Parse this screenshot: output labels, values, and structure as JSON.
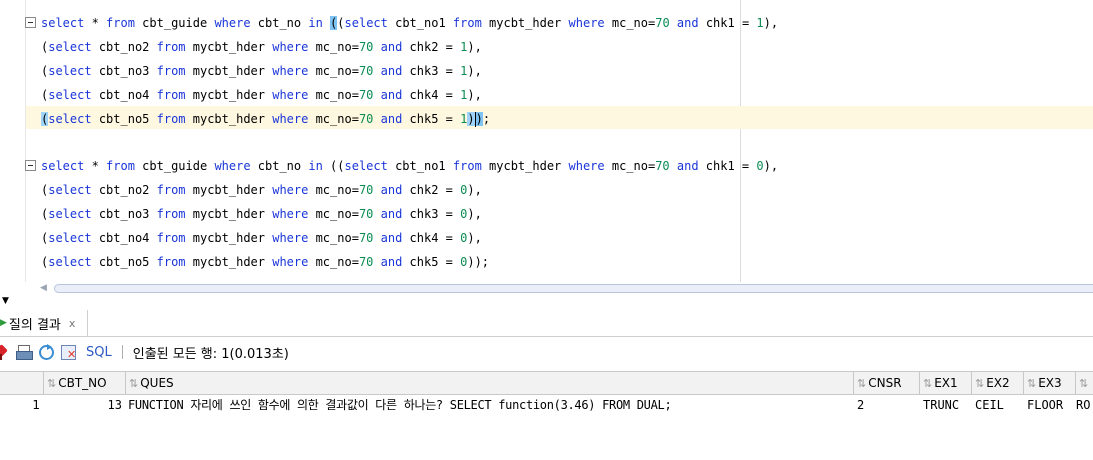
{
  "editor": {
    "blocks": [
      {
        "lines": [
          [
            {
              "t": "select",
              "c": "kw"
            },
            {
              "t": " * "
            },
            {
              "t": "from",
              "c": "kw"
            },
            {
              "t": " cbt_guide "
            },
            {
              "t": "where",
              "c": "kw"
            },
            {
              "t": " cbt_no "
            },
            {
              "t": "in",
              "c": "kw"
            },
            {
              "t": " "
            },
            {
              "t": "(",
              "c": "hl"
            },
            {
              "t": "("
            },
            {
              "t": "select",
              "c": "kw"
            },
            {
              "t": " cbt_no1 "
            },
            {
              "t": "from",
              "c": "kw"
            },
            {
              "t": " mycbt_hder "
            },
            {
              "t": "where",
              "c": "kw"
            },
            {
              "t": " mc_no="
            },
            {
              "t": "70",
              "c": "num"
            },
            {
              "t": " "
            },
            {
              "t": "and",
              "c": "kw"
            },
            {
              "t": " chk1 = "
            },
            {
              "t": "1",
              "c": "num"
            },
            {
              "t": "),"
            }
          ],
          [
            {
              "t": "("
            },
            {
              "t": "select",
              "c": "kw"
            },
            {
              "t": " cbt_no2 "
            },
            {
              "t": "from",
              "c": "kw"
            },
            {
              "t": " mycbt_hder "
            },
            {
              "t": "where",
              "c": "kw"
            },
            {
              "t": " mc_no="
            },
            {
              "t": "70",
              "c": "num"
            },
            {
              "t": " "
            },
            {
              "t": "and",
              "c": "kw"
            },
            {
              "t": " chk2 = "
            },
            {
              "t": "1",
              "c": "num"
            },
            {
              "t": "),"
            }
          ],
          [
            {
              "t": "("
            },
            {
              "t": "select",
              "c": "kw"
            },
            {
              "t": " cbt_no3 "
            },
            {
              "t": "from",
              "c": "kw"
            },
            {
              "t": " mycbt_hder "
            },
            {
              "t": "where",
              "c": "kw"
            },
            {
              "t": " mc_no="
            },
            {
              "t": "70",
              "c": "num"
            },
            {
              "t": " "
            },
            {
              "t": "and",
              "c": "kw"
            },
            {
              "t": " chk3 = "
            },
            {
              "t": "1",
              "c": "num"
            },
            {
              "t": "),"
            }
          ],
          [
            {
              "t": "("
            },
            {
              "t": "select",
              "c": "kw"
            },
            {
              "t": " cbt_no4 "
            },
            {
              "t": "from",
              "c": "kw"
            },
            {
              "t": " mycbt_hder "
            },
            {
              "t": "where",
              "c": "kw"
            },
            {
              "t": " mc_no="
            },
            {
              "t": "70",
              "c": "num"
            },
            {
              "t": " "
            },
            {
              "t": "and",
              "c": "kw"
            },
            {
              "t": " chk4 = "
            },
            {
              "t": "1",
              "c": "num"
            },
            {
              "t": "),"
            }
          ],
          [
            {
              "t": "(",
              "c": "hl2"
            },
            {
              "t": "select",
              "c": "kw"
            },
            {
              "t": " cbt_no5 "
            },
            {
              "t": "from",
              "c": "kw"
            },
            {
              "t": " mycbt_hder "
            },
            {
              "t": "where",
              "c": "kw"
            },
            {
              "t": " mc_no="
            },
            {
              "t": "70",
              "c": "num"
            },
            {
              "t": " "
            },
            {
              "t": "and",
              "c": "kw"
            },
            {
              "t": " chk5 = "
            },
            {
              "t": "1",
              "c": "num"
            },
            {
              "t": ")",
              "c": "hl2"
            },
            {
              "t": "CARET",
              "c": "caret"
            },
            {
              "t": ")",
              "c": "hl"
            },
            {
              "t": ";"
            }
          ]
        ]
      },
      {
        "lines": [
          [
            {
              "t": "select",
              "c": "kw"
            },
            {
              "t": " * "
            },
            {
              "t": "from",
              "c": "kw"
            },
            {
              "t": " cbt_guide "
            },
            {
              "t": "where",
              "c": "kw"
            },
            {
              "t": " cbt_no "
            },
            {
              "t": "in",
              "c": "kw"
            },
            {
              "t": " (("
            },
            {
              "t": "select",
              "c": "kw"
            },
            {
              "t": " cbt_no1 "
            },
            {
              "t": "from",
              "c": "kw"
            },
            {
              "t": " mycbt_hder "
            },
            {
              "t": "where",
              "c": "kw"
            },
            {
              "t": " mc_no="
            },
            {
              "t": "70",
              "c": "num"
            },
            {
              "t": " "
            },
            {
              "t": "and",
              "c": "kw"
            },
            {
              "t": " chk1 = "
            },
            {
              "t": "0",
              "c": "num"
            },
            {
              "t": "),"
            }
          ],
          [
            {
              "t": "("
            },
            {
              "t": "select",
              "c": "kw"
            },
            {
              "t": " cbt_no2 "
            },
            {
              "t": "from",
              "c": "kw"
            },
            {
              "t": " mycbt_hder "
            },
            {
              "t": "where",
              "c": "kw"
            },
            {
              "t": " mc_no="
            },
            {
              "t": "70",
              "c": "num"
            },
            {
              "t": " "
            },
            {
              "t": "and",
              "c": "kw"
            },
            {
              "t": " chk2 = "
            },
            {
              "t": "0",
              "c": "num"
            },
            {
              "t": "),"
            }
          ],
          [
            {
              "t": "("
            },
            {
              "t": "select",
              "c": "kw"
            },
            {
              "t": " cbt_no3 "
            },
            {
              "t": "from",
              "c": "kw"
            },
            {
              "t": " mycbt_hder "
            },
            {
              "t": "where",
              "c": "kw"
            },
            {
              "t": " mc_no="
            },
            {
              "t": "70",
              "c": "num"
            },
            {
              "t": " "
            },
            {
              "t": "and",
              "c": "kw"
            },
            {
              "t": " chk3 = "
            },
            {
              "t": "0",
              "c": "num"
            },
            {
              "t": "),"
            }
          ],
          [
            {
              "t": "("
            },
            {
              "t": "select",
              "c": "kw"
            },
            {
              "t": " cbt_no4 "
            },
            {
              "t": "from",
              "c": "kw"
            },
            {
              "t": " mycbt_hder "
            },
            {
              "t": "where",
              "c": "kw"
            },
            {
              "t": " mc_no="
            },
            {
              "t": "70",
              "c": "num"
            },
            {
              "t": " "
            },
            {
              "t": "and",
              "c": "kw"
            },
            {
              "t": " chk4 = "
            },
            {
              "t": "0",
              "c": "num"
            },
            {
              "t": "),"
            }
          ],
          [
            {
              "t": "("
            },
            {
              "t": "select",
              "c": "kw"
            },
            {
              "t": " cbt_no5 "
            },
            {
              "t": "from",
              "c": "kw"
            },
            {
              "t": " mycbt_hder "
            },
            {
              "t": "where",
              "c": "kw"
            },
            {
              "t": " mc_no="
            },
            {
              "t": "70",
              "c": "num"
            },
            {
              "t": " "
            },
            {
              "t": "and",
              "c": "kw"
            },
            {
              "t": " chk5 = "
            },
            {
              "t": "0",
              "c": "num"
            },
            {
              "t": "));"
            }
          ]
        ]
      }
    ]
  },
  "results": {
    "tab_label": "질의 결과",
    "tab_close": "x",
    "toolbar": {
      "icons": [
        "pin-icon",
        "print-icon",
        "refresh-icon",
        "sql-cancel-icon"
      ],
      "sql_label": "SQL",
      "separator": "|",
      "status": "인출된 모든 행: 1(0.013초)"
    },
    "columns": [
      "CBT_NO",
      "QUES",
      "CNSR",
      "EX1",
      "EX2",
      "EX3",
      ""
    ],
    "rows": [
      {
        "num": "1",
        "cbt_no": "13",
        "ques": "FUNCTION 자리에 쓰인 함수에 의한 결과값이 다른 하나는? SELECT function(3.46) FROM DUAL;",
        "cnsr": "2",
        "ex1": "TRUNC",
        "ex2": "CEIL",
        "ex3": "FLOOR",
        "ex4": "RO"
      }
    ]
  },
  "colors": {
    "keyword": "#1a35d8",
    "number": "#0a8c52",
    "bracket_highlight": "#7ec3f2",
    "current_line": "#fff8e1"
  }
}
